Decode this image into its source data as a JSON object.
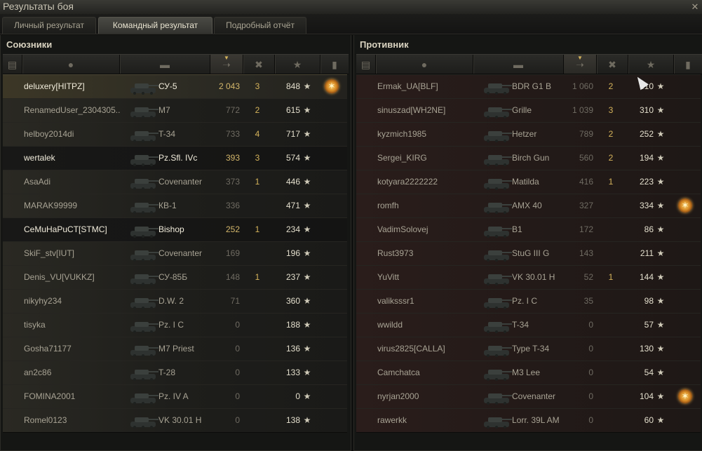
{
  "window": {
    "title": "Результаты боя"
  },
  "tabs": [
    {
      "label": "Личный результат"
    },
    {
      "label": "Командный результат"
    },
    {
      "label": "Подробный отчёт"
    }
  ],
  "allies": {
    "title": "Союзники",
    "rows": [
      {
        "name": "deluxery[HITPZ]",
        "vehicle": "СУ-5",
        "damage": "2 043",
        "kills": "3",
        "xp": "848",
        "medal": true
      },
      {
        "name": "RenamedUser_2304305..",
        "vehicle": "M7",
        "damage": "772",
        "kills": "2",
        "xp": "615",
        "medal": false
      },
      {
        "name": "helboy2014di",
        "vehicle": "T-34",
        "damage": "733",
        "kills": "4",
        "xp": "717",
        "medal": false
      },
      {
        "name": "wertalek",
        "vehicle": "Pz.Sfl. IVc",
        "damage": "393",
        "kills": "3",
        "xp": "574",
        "medal": false
      },
      {
        "name": "AsaAdi",
        "vehicle": "Covenanter",
        "damage": "373",
        "kills": "1",
        "xp": "446",
        "medal": false
      },
      {
        "name": "MARAK99999",
        "vehicle": "КВ-1",
        "damage": "336",
        "kills": "",
        "xp": "471",
        "medal": false
      },
      {
        "name": "CeMuHaPuCT[STMC]",
        "vehicle": "Bishop",
        "damage": "252",
        "kills": "1",
        "xp": "234",
        "medal": false
      },
      {
        "name": "SkiF_stv[IUT]",
        "vehicle": "Covenanter",
        "damage": "169",
        "kills": "",
        "xp": "196",
        "medal": false
      },
      {
        "name": "Denis_VU[VUKKZ]",
        "vehicle": "СУ-85Б",
        "damage": "148",
        "kills": "1",
        "xp": "237",
        "medal": false
      },
      {
        "name": "nikyhy234",
        "vehicle": "D.W. 2",
        "damage": "71",
        "kills": "",
        "xp": "360",
        "medal": false
      },
      {
        "name": "tisyka",
        "vehicle": "Pz. I C",
        "damage": "0",
        "kills": "",
        "xp": "188",
        "medal": false
      },
      {
        "name": "Gosha71177",
        "vehicle": "M7 Priest",
        "damage": "0",
        "kills": "",
        "xp": "136",
        "medal": false
      },
      {
        "name": "an2c86",
        "vehicle": "T-28",
        "damage": "0",
        "kills": "",
        "xp": "133",
        "medal": false
      },
      {
        "name": "FOMINA2001",
        "vehicle": "Pz. IV A",
        "damage": "0",
        "kills": "",
        "xp": "0",
        "medal": false
      },
      {
        "name": "Romel0123",
        "vehicle": "VK 30.01 H",
        "damage": "0",
        "kills": "",
        "xp": "138",
        "medal": false
      }
    ]
  },
  "enemies": {
    "title": "Противник",
    "rows": [
      {
        "name": "Ermak_UA[BLF]",
        "vehicle": "BDR G1 B",
        "damage": "1 060",
        "kills": "2",
        "xp": "310",
        "medal": false
      },
      {
        "name": "sinuszad[WH2NE]",
        "vehicle": "Grille",
        "damage": "1 039",
        "kills": "3",
        "xp": "310",
        "medal": false
      },
      {
        "name": "kyzmich1985",
        "vehicle": "Hetzer",
        "damage": "789",
        "kills": "2",
        "xp": "252",
        "medal": false
      },
      {
        "name": "Sergei_KIRG",
        "vehicle": "Birch Gun",
        "damage": "560",
        "kills": "2",
        "xp": "194",
        "medal": false
      },
      {
        "name": "kotyara2222222",
        "vehicle": "Matilda",
        "damage": "416",
        "kills": "1",
        "xp": "223",
        "medal": false
      },
      {
        "name": "romfh",
        "vehicle": "AMX 40",
        "damage": "327",
        "kills": "",
        "xp": "334",
        "medal": true
      },
      {
        "name": "VadimSolovej",
        "vehicle": "B1",
        "damage": "172",
        "kills": "",
        "xp": "86",
        "medal": false
      },
      {
        "name": "Rust3973",
        "vehicle": "StuG III G",
        "damage": "143",
        "kills": "",
        "xp": "211",
        "medal": false
      },
      {
        "name": "YuVitt",
        "vehicle": "VK 30.01 H",
        "damage": "52",
        "kills": "1",
        "xp": "144",
        "medal": false
      },
      {
        "name": "valiksssr1",
        "vehicle": "Pz. I C",
        "damage": "35",
        "kills": "",
        "xp": "98",
        "medal": false
      },
      {
        "name": "wwildd",
        "vehicle": "T-34",
        "damage": "0",
        "kills": "",
        "xp": "57",
        "medal": false
      },
      {
        "name": "virus2825[CALLA]",
        "vehicle": "Type T-34",
        "damage": "0",
        "kills": "",
        "xp": "130",
        "medal": false
      },
      {
        "name": "Camchatca",
        "vehicle": "M3 Lee",
        "damage": "0",
        "kills": "",
        "xp": "54",
        "medal": false
      },
      {
        "name": "nyrjan2000",
        "vehicle": "Covenanter",
        "damage": "0",
        "kills": "",
        "xp": "104",
        "medal": true
      },
      {
        "name": "rawerkk",
        "vehicle": "Lorr. 39L AM",
        "damage": "0",
        "kills": "",
        "xp": "60",
        "medal": false
      }
    ]
  },
  "icons": {
    "star": "★",
    "sort": "▼",
    "close": "✕"
  }
}
